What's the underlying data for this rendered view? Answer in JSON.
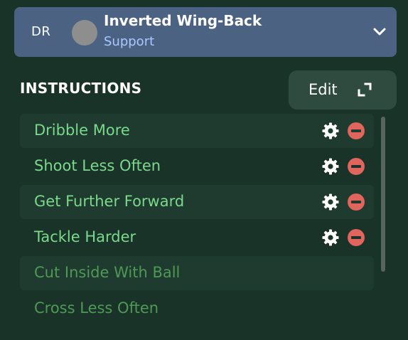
{
  "role": {
    "position": "DR",
    "name": "Inverted Wing-Back",
    "duty": "Support"
  },
  "instructions": {
    "title": "INSTRUCTIONS",
    "edit_label": "Edit",
    "items": [
      {
        "label": "Dribble More",
        "active": true
      },
      {
        "label": "Shoot Less Often",
        "active": true
      },
      {
        "label": "Get Further Forward",
        "active": true
      },
      {
        "label": "Tackle Harder",
        "active": true
      },
      {
        "label": "Cut Inside With Ball",
        "active": false
      },
      {
        "label": "Cross Less Often",
        "active": false
      }
    ]
  },
  "icons": {
    "dropdown": "chevron-down-icon",
    "edit": "expand-icon",
    "settings": "gear-icon",
    "remove": "remove-icon"
  },
  "colors": {
    "background": "#1a3329",
    "header": "#4b6283",
    "active_text": "#7ad98a",
    "inactive_text": "#4e9a55",
    "remove": "#e0655c"
  }
}
